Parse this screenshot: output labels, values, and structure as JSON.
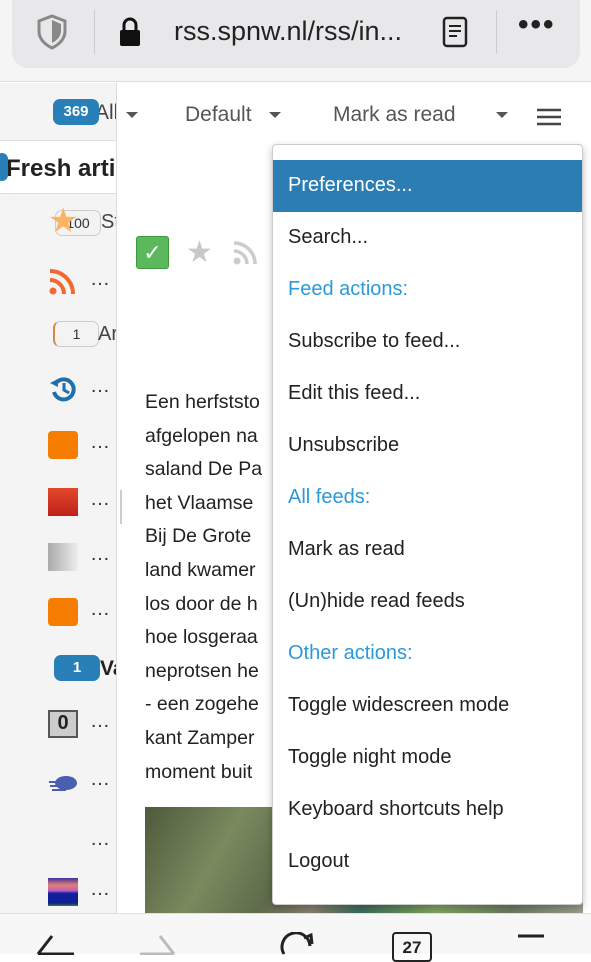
{
  "browser": {
    "url": "rss.spnw.nl/rss/in...",
    "tab_count": "27"
  },
  "sidebar": {
    "all_count": "369",
    "all_label": "All",
    "fresh_label": "Fresh artic",
    "starred_count": "100",
    "starred_label": "Sta",
    "archived_count": "1",
    "archived_label": "Arc",
    "feed_ellipsis": "…",
    "category_count": "1",
    "category_label": "Va"
  },
  "toolbar": {
    "view_mode": "Default",
    "mark_as_read": "Mark as read"
  },
  "article": {
    "lines": [
      "Een herfststo",
      "afgelopen na",
      "saland De Pa",
      "het Vlaamse",
      "Bij De Grote",
      "land kwamer",
      "los door de h",
      "hoe losgeraa",
      "neprotsen he",
      "- een zogehe",
      "kant Zamper",
      "moment buit"
    ]
  },
  "menu": {
    "items": [
      {
        "label": "Preferences...",
        "type": "item",
        "selected": true
      },
      {
        "label": "Search...",
        "type": "item"
      },
      {
        "label": "Feed actions:",
        "type": "header"
      },
      {
        "label": "Subscribe to feed...",
        "type": "item"
      },
      {
        "label": "Edit this feed...",
        "type": "item"
      },
      {
        "label": "Unsubscribe",
        "type": "item"
      },
      {
        "label": "All feeds:",
        "type": "header"
      },
      {
        "label": "Mark as read",
        "type": "item"
      },
      {
        "label": "(Un)hide read feeds",
        "type": "item"
      },
      {
        "label": "Other actions:",
        "type": "header"
      },
      {
        "label": "Toggle widescreen mode",
        "type": "item"
      },
      {
        "label": "Toggle night mode",
        "type": "item"
      },
      {
        "label": "Keyboard shortcuts help",
        "type": "item"
      },
      {
        "label": "Logout",
        "type": "item"
      }
    ]
  },
  "colors": {
    "accent": "#2c7db3",
    "header": "#2a9ad9",
    "badge": "#2980b9"
  }
}
